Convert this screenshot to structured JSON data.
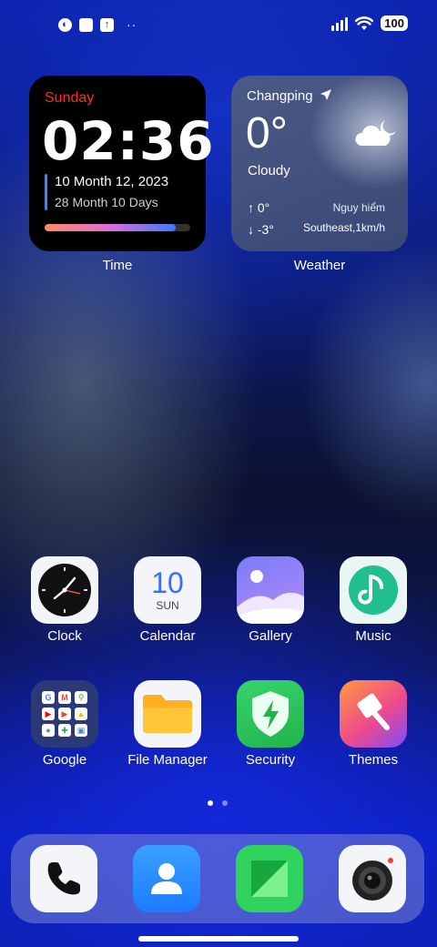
{
  "status_bar": {
    "battery": "100",
    "dots": "··"
  },
  "widgets": {
    "time": {
      "day": "Sunday",
      "clock": "02:36",
      "date": "10 Month 12, 2023",
      "lunar": "28 Month 10 Days",
      "progress_fraction": 0.9,
      "label": "Time"
    },
    "weather": {
      "location": "Changping",
      "temperature": "0°",
      "condition": "Cloudy",
      "high": "0°",
      "low": "-3°",
      "status": "Nguy hiểm",
      "wind": "Southeast,1km/h",
      "label": "Weather"
    }
  },
  "apps_row1": [
    {
      "label": "Clock",
      "icon": "clock-icon"
    },
    {
      "label": "Calendar",
      "icon": "calendar-icon",
      "day_number": "10",
      "day_name": "SUN"
    },
    {
      "label": "Gallery",
      "icon": "gallery-icon"
    },
    {
      "label": "Music",
      "icon": "music-icon"
    }
  ],
  "apps_row2": [
    {
      "label": "Google",
      "icon": "google-folder-icon"
    },
    {
      "label": "File Manager",
      "icon": "folder-icon"
    },
    {
      "label": "Security",
      "icon": "shield-icon"
    },
    {
      "label": "Themes",
      "icon": "brush-icon"
    }
  ],
  "google_folder": [
    "G",
    "M",
    "⚲",
    "▶",
    "▶",
    "▲",
    "●",
    "✚",
    "▣"
  ],
  "dock": [
    {
      "icon": "phone-icon"
    },
    {
      "icon": "contacts-icon"
    },
    {
      "icon": "messages-icon"
    },
    {
      "icon": "camera-icon"
    }
  ],
  "pager": {
    "pages": 2,
    "active": 1
  },
  "colors": {
    "accent_red": "#ff2a2a",
    "accent_blue": "#2f8cff",
    "security_green": "#2fd35d",
    "contacts_blue": "#1c7bff"
  }
}
